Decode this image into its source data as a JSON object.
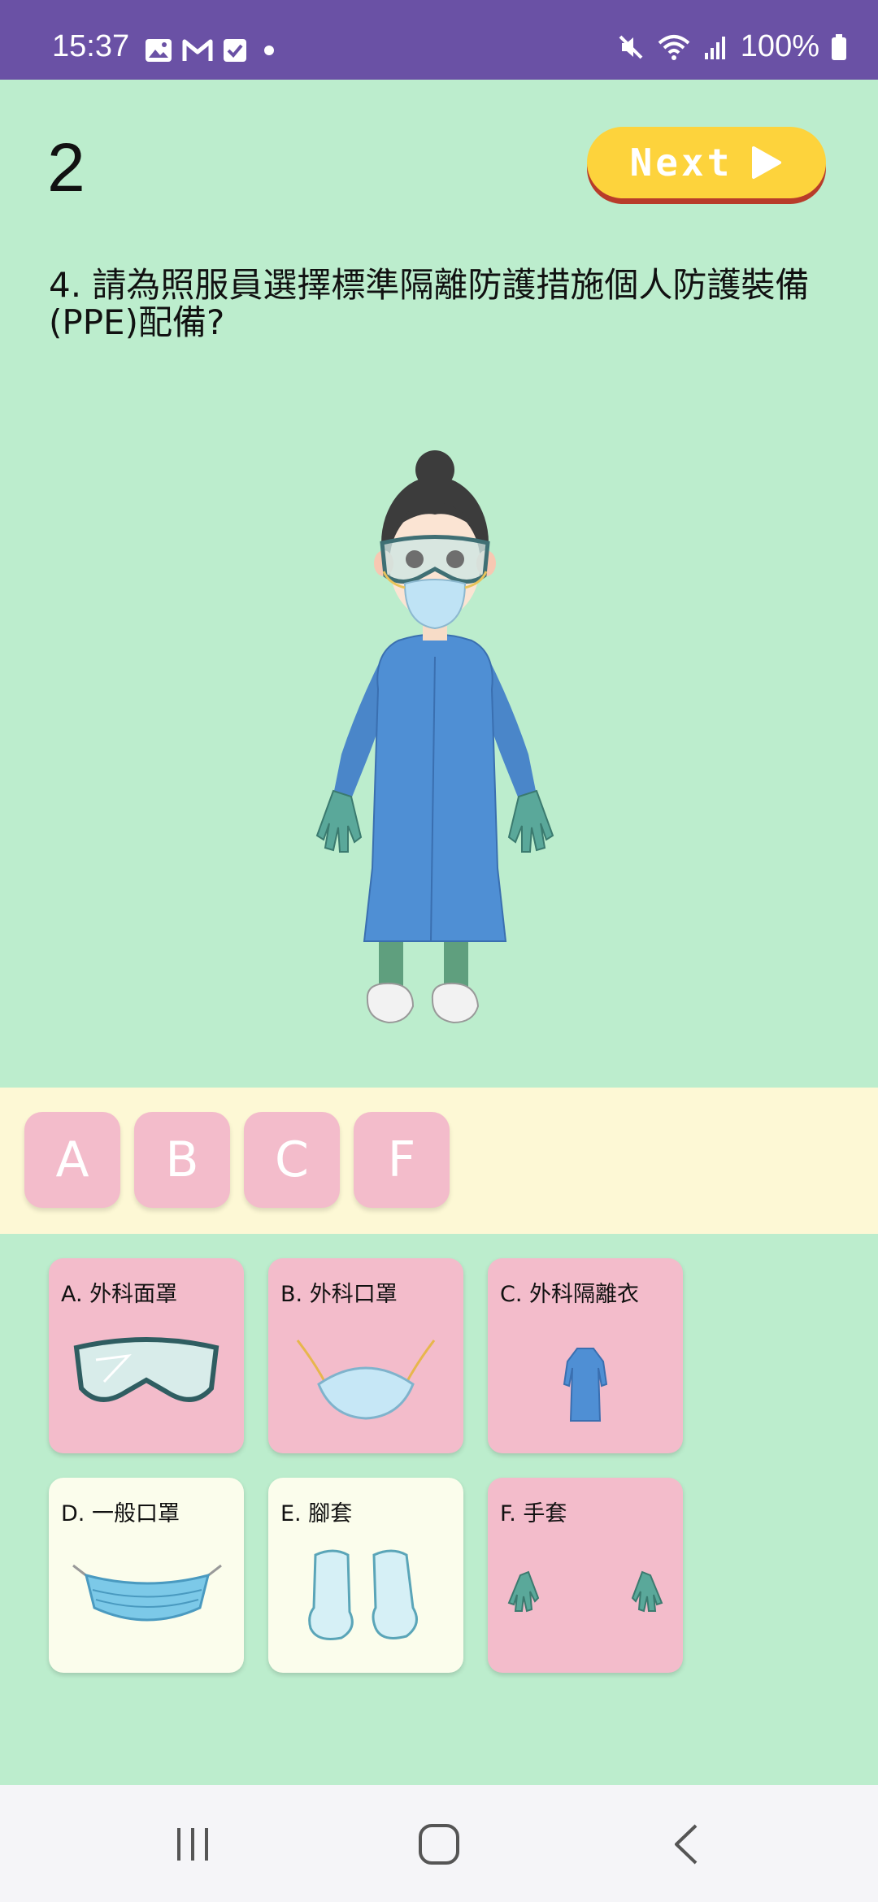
{
  "status_bar": {
    "time": "15:37",
    "notification_icons": [
      "image-icon",
      "gmail-icon",
      "check-box-icon",
      "dot-icon"
    ],
    "system_icons": [
      "mute-icon",
      "wifi-icon",
      "signal-icon",
      "battery-icon"
    ],
    "battery": "100%"
  },
  "header": {
    "score": "2",
    "next_label": "Next"
  },
  "question": {
    "text": "4. 請為照服員選擇標準隔離防護措施個人防護裝備(PPE)配備?"
  },
  "answer_slots": [
    "A",
    "B",
    "C",
    "F"
  ],
  "options": [
    {
      "label": "A.  外科面罩",
      "item": "goggles-icon",
      "selected": true
    },
    {
      "label": "B.  外科口罩",
      "item": "surgical-mask-icon",
      "selected": true
    },
    {
      "label": "C.  外科隔離衣",
      "item": "gown-icon",
      "selected": true
    },
    {
      "label": "D.  一般口罩",
      "item": "general-mask-icon",
      "selected": false
    },
    {
      "label": "E.  腳套",
      "item": "shoe-covers-icon",
      "selected": false
    },
    {
      "label": "F.  手套",
      "item": "gloves-icon",
      "selected": true
    }
  ],
  "colors": {
    "status_bar": "#6a51a5",
    "background": "#bcedcd",
    "answer_strip": "#fdf8d5",
    "selected_card": "#f3bccb",
    "unselected_card": "#fbfdec",
    "next_button": "#fdd33c"
  },
  "nav_bar": {
    "buttons": [
      "recent-apps-icon",
      "home-icon",
      "back-icon"
    ]
  }
}
